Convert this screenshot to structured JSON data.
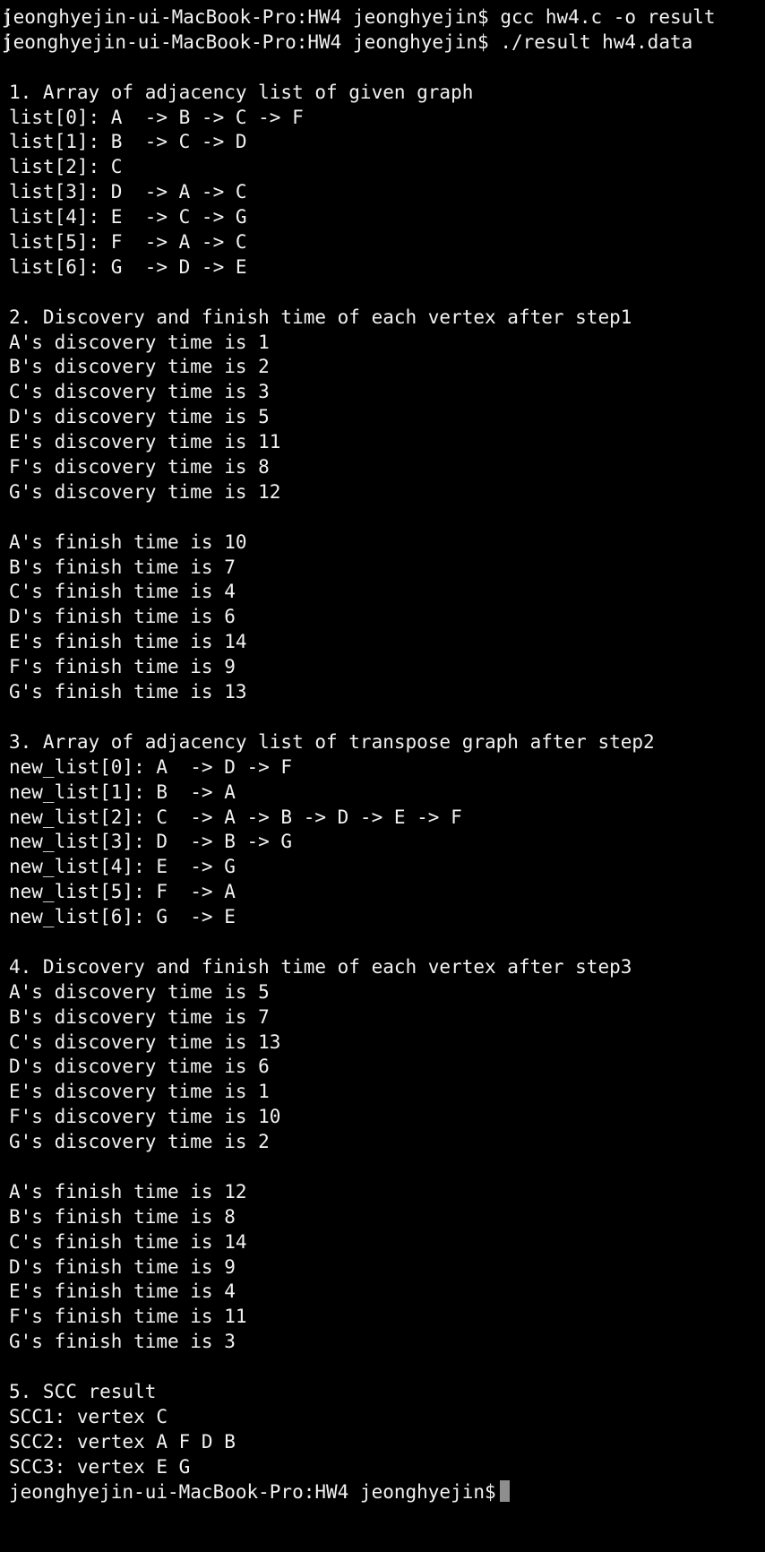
{
  "terminal": {
    "prompt": "jeonghyejin-ui-MacBook-Pro:HW4 jeonghyejin$",
    "commands": [
      "gcc hw4.c -o result",
      "./result hw4.data"
    ],
    "section1": {
      "title": "1. Array of adjacency list of given graph",
      "lines": [
        "list[0]: A  -> B -> C -> F",
        "list[1]: B  -> C -> D",
        "list[2]: C",
        "list[3]: D  -> A -> C",
        "list[4]: E  -> C -> G",
        "list[5]: F  -> A -> C",
        "list[6]: G  -> D -> E"
      ]
    },
    "section2": {
      "title": "2. Discovery and finish time of each vertex after step1",
      "discovery": [
        "A's discovery time is 1",
        "B's discovery time is 2",
        "C's discovery time is 3",
        "D's discovery time is 5",
        "E's discovery time is 11",
        "F's discovery time is 8",
        "G's discovery time is 12"
      ],
      "finish": [
        "A's finish time is 10",
        "B's finish time is 7",
        "C's finish time is 4",
        "D's finish time is 6",
        "E's finish time is 14",
        "F's finish time is 9",
        "G's finish time is 13"
      ]
    },
    "section3": {
      "title": "3. Array of adjacency list of transpose graph after step2",
      "lines": [
        "new_list[0]: A  -> D -> F",
        "new_list[1]: B  -> A",
        "new_list[2]: C  -> A -> B -> D -> E -> F",
        "new_list[3]: D  -> B -> G",
        "new_list[4]: E  -> G",
        "new_list[5]: F  -> A",
        "new_list[6]: G  -> E"
      ]
    },
    "section4": {
      "title": "4. Discovery and finish time of each vertex after step3",
      "discovery": [
        "A's discovery time is 5",
        "B's discovery time is 7",
        "C's discovery time is 13",
        "D's discovery time is 6",
        "E's discovery time is 1",
        "F's discovery time is 10",
        "G's discovery time is 2"
      ],
      "finish": [
        "A's finish time is 12",
        "B's finish time is 8",
        "C's finish time is 14",
        "D's finish time is 9",
        "E's finish time is 4",
        "F's finish time is 11",
        "G's finish time is 3"
      ]
    },
    "section5": {
      "title": "5. SCC result",
      "lines": [
        "SCC1: vertex C",
        "SCC2: vertex A F D B",
        "SCC3: vertex E G"
      ]
    }
  }
}
